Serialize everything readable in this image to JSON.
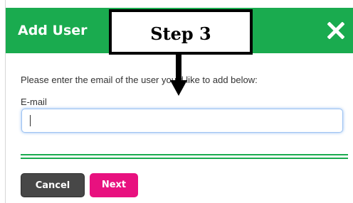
{
  "dialog": {
    "title": "Add User",
    "close_icon": "close-x-icon",
    "instruction": "Please enter the email of the user you'd like to add below:",
    "email": {
      "label": "E-mail",
      "value": "",
      "placeholder": ""
    },
    "buttons": {
      "cancel_label": "Cancel",
      "next_label": "Next"
    }
  },
  "callout": {
    "label": "Step 3",
    "arrow_icon": "down-arrow-icon"
  },
  "colors": {
    "header_green": "#1aab4f",
    "next_pink": "#e8117f",
    "cancel_gray": "#474747",
    "input_focus_blue": "#9ec3f2"
  }
}
